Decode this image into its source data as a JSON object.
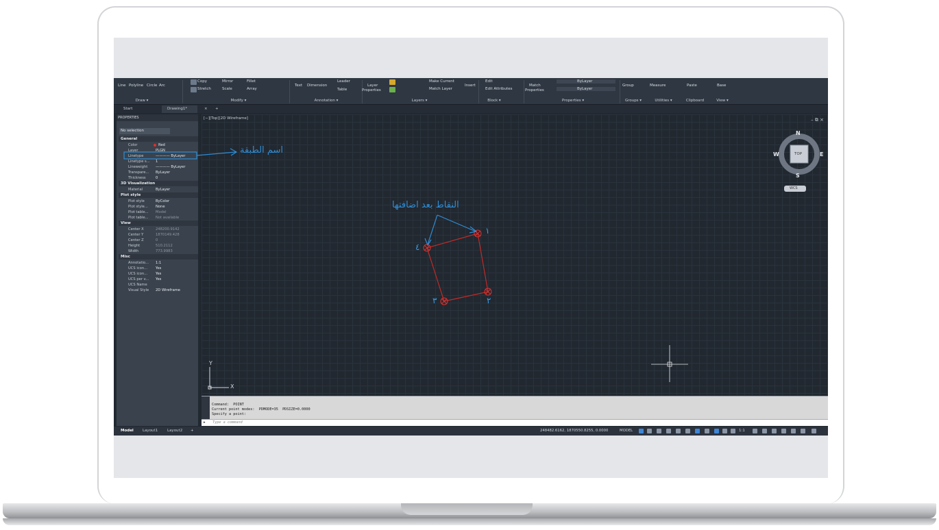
{
  "ribbon": {
    "draw": {
      "line": "Line",
      "polyline": "Polyline",
      "circle": "Circle",
      "arc": "Arc",
      "label": "Draw ▾"
    },
    "modify": {
      "copy": "Copy",
      "mirror": "Mirror",
      "fillet": "Fillet",
      "stretch": "Stretch",
      "scale": "Scale",
      "array": "Array",
      "label": "Modify ▾"
    },
    "annotation": {
      "text": "Text",
      "dimension": "Dimension",
      "leader": "Leader",
      "table": "Table",
      "label": "Annotation ▾"
    },
    "layers": {
      "layer_properties_1": "Layer",
      "layer_properties_2": "Properties",
      "make_current": "Make Current",
      "match_layer": "Match Layer",
      "label": "Layers ▾"
    },
    "block": {
      "insert": "Insert",
      "edit": "Edit",
      "edit_attributes": "Edit Attributes",
      "label": "Block ▾"
    },
    "properties": {
      "match_1": "Match",
      "match_2": "Properties",
      "bylayer_1": "ByLayer",
      "bylayer_2": "ByLayer",
      "label": "Properties ▾"
    },
    "groups": {
      "group": "Group",
      "label": "Groups ▾"
    },
    "utilities": {
      "measure": "Measure",
      "label": "Utilities ▾"
    },
    "clipboard": {
      "paste": "Paste",
      "label": "Clipboard"
    },
    "view": {
      "base": "Base",
      "label": "View ▾"
    }
  },
  "tabs": {
    "start": "Start",
    "drawing": "Drawing1*",
    "close": "×",
    "add": "+"
  },
  "properties_panel": {
    "title": "PROPERTIES",
    "selection": "No selection",
    "general": {
      "header": "General",
      "rows": [
        {
          "k": "Color",
          "v": "Red"
        },
        {
          "k": "Layer",
          "v": "PLGN"
        },
        {
          "k": "Linetype",
          "v": "———— ByLayer"
        },
        {
          "k": "Linetype s...",
          "v": "1"
        },
        {
          "k": "Lineweight",
          "v": "———— ByLayer"
        },
        {
          "k": "Transpare...",
          "v": "ByLayer"
        },
        {
          "k": "Thickness",
          "v": "0"
        }
      ]
    },
    "viz3d": {
      "header": "3D Visualization",
      "rows": [
        {
          "k": "Material",
          "v": "ByLayer"
        }
      ]
    },
    "plot": {
      "header": "Plot style",
      "rows": [
        {
          "k": "Plot style",
          "v": "ByColor"
        },
        {
          "k": "Plot style...",
          "v": "None"
        },
        {
          "k": "Plot table...",
          "v": "Model"
        },
        {
          "k": "Plot table...",
          "v": "Not available"
        }
      ]
    },
    "view": {
      "header": "View",
      "rows": [
        {
          "k": "Center X",
          "v": "248200.9142"
        },
        {
          "k": "Center Y",
          "v": "1870149.428"
        },
        {
          "k": "Center Z",
          "v": "0"
        },
        {
          "k": "Height",
          "v": "510.2112"
        },
        {
          "k": "Width",
          "v": "773.9983"
        }
      ]
    },
    "misc": {
      "header": "Misc",
      "rows": [
        {
          "k": "Annotatio...",
          "v": "1:1"
        },
        {
          "k": "UCS icon...",
          "v": "Yes"
        },
        {
          "k": "UCS icon...",
          "v": "Yes"
        },
        {
          "k": "UCS per v...",
          "v": "Yes"
        },
        {
          "k": "UCS Name",
          "v": ""
        },
        {
          "k": "Visual Style",
          "v": "2D Wireframe"
        }
      ]
    }
  },
  "viewport": {
    "label": "[−][Top][2D Wireframe]",
    "controls": "– ⧉ ×"
  },
  "viewcube": {
    "n": "N",
    "s": "S",
    "e": "E",
    "w": "W",
    "top": "TOP",
    "wcs": "WCS"
  },
  "ucs": {
    "x": "X",
    "y": "Y"
  },
  "annotations": {
    "layer_name": "اسم الطبقة",
    "points_added": "النقاط بعد اضافتها",
    "p1": "١",
    "p2": "٢",
    "p3": "٣",
    "p4": "٤"
  },
  "command": {
    "line1": "Command:  POINT",
    "line2": "Current point modes:  PDMODE=35  PDSIZE=0.0000",
    "line3": "Specify a point:",
    "placeholder": "Type a command"
  },
  "status": {
    "model_tab": "Model",
    "layout1": "Layout1",
    "layout2": "Layout2",
    "add": "+",
    "coords": "248482.6162, 1870550.8255, 0.0000",
    "model": "MODEL",
    "scale": "1:1"
  },
  "colors": {
    "accent": "#2f8ed6",
    "point_red": "#e0302c",
    "bg": "#212830"
  }
}
